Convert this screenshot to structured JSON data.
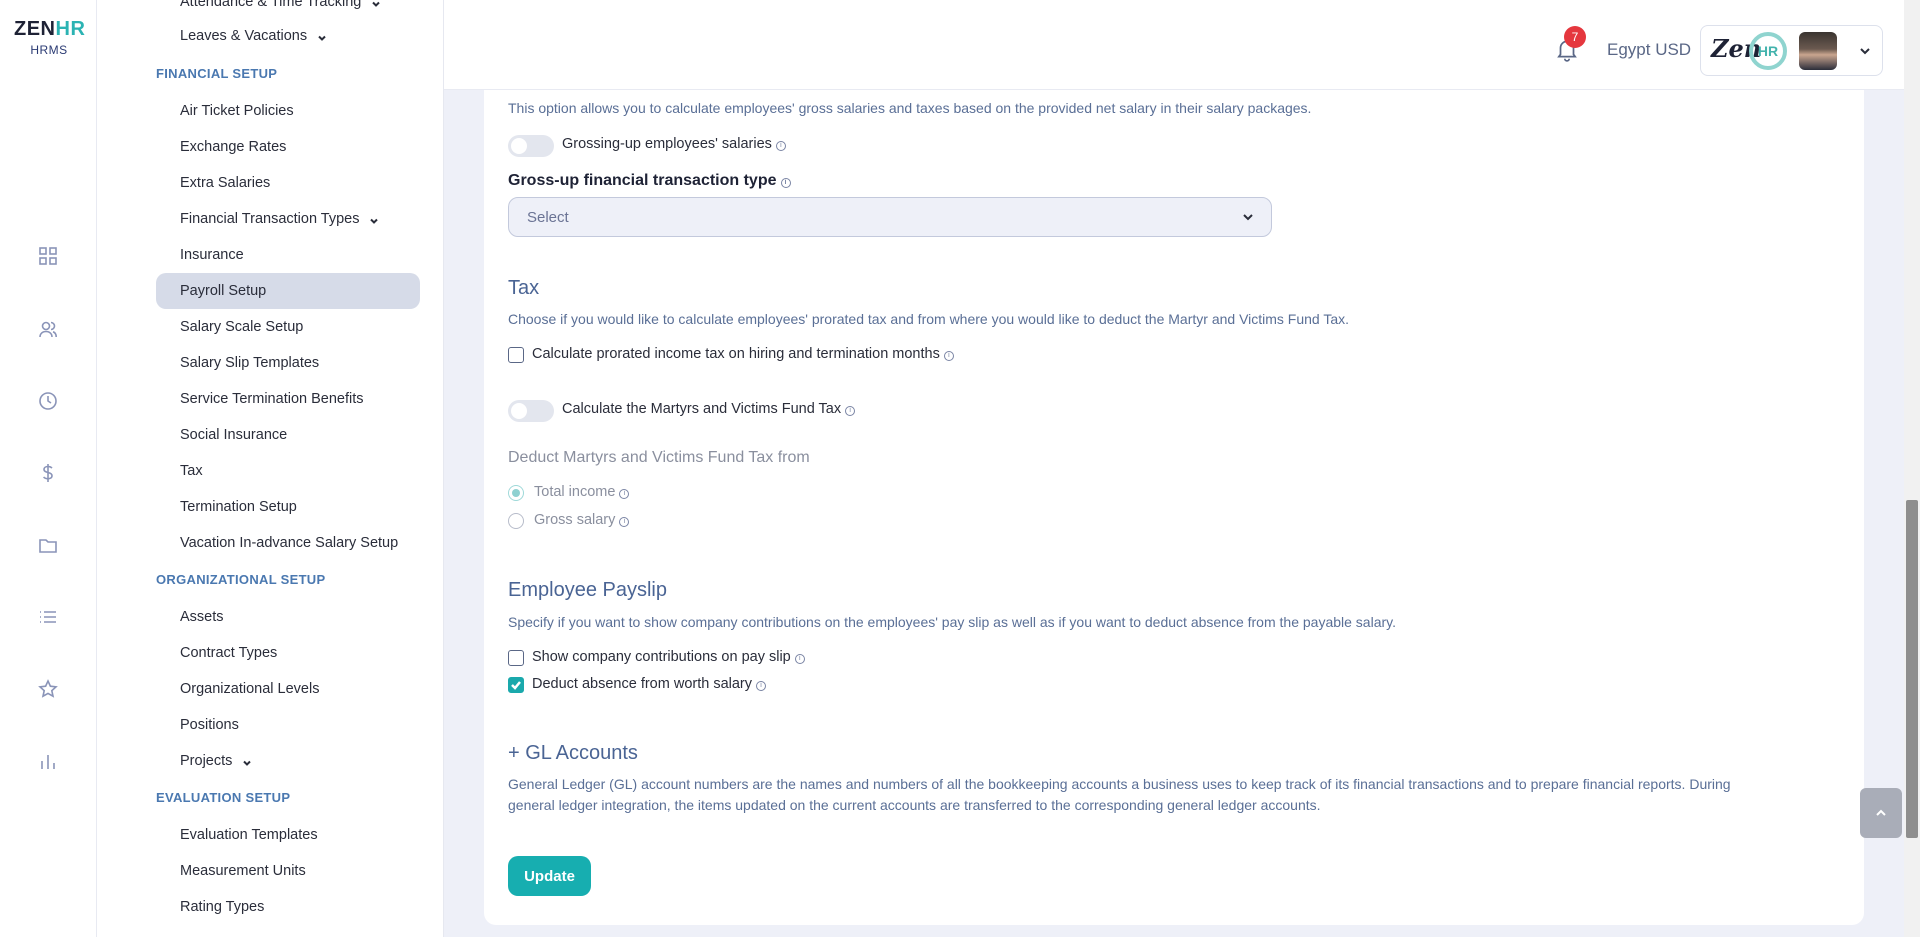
{
  "brand": {
    "zen": "ZEN",
    "hr": "HR",
    "sub": "HRMS"
  },
  "rail_icons": [
    "dashboard-icon",
    "users-icon",
    "clock-icon",
    "dollar-icon",
    "folder-icon",
    "list-icon",
    "star-icon",
    "chart-icon"
  ],
  "sidebar": {
    "top_items": [
      {
        "label": "Attendance & Time Tracking",
        "has_chevron": true
      },
      {
        "label": "Leaves & Vacations",
        "has_chevron": true
      }
    ],
    "financial": {
      "title": "FINANCIAL SETUP",
      "items": [
        {
          "label": "Air Ticket Policies"
        },
        {
          "label": "Exchange Rates"
        },
        {
          "label": "Extra Salaries"
        },
        {
          "label": "Financial Transaction Types",
          "has_chevron": true
        },
        {
          "label": "Insurance"
        },
        {
          "label": "Payroll Setup",
          "active": true
        },
        {
          "label": "Salary Scale Setup"
        },
        {
          "label": "Salary Slip Templates"
        },
        {
          "label": "Service Termination Benefits"
        },
        {
          "label": "Social Insurance"
        },
        {
          "label": "Tax"
        },
        {
          "label": "Termination Setup"
        },
        {
          "label": "Vacation In-advance Salary Setup"
        }
      ]
    },
    "organizational": {
      "title": "ORGANIZATIONAL SETUP",
      "items": [
        {
          "label": "Assets"
        },
        {
          "label": "Contract Types"
        },
        {
          "label": "Organizational Levels"
        },
        {
          "label": "Positions"
        },
        {
          "label": "Projects",
          "has_chevron": true
        }
      ]
    },
    "evaluation": {
      "title": "EVALUATION SETUP",
      "items": [
        {
          "label": "Evaluation Templates"
        },
        {
          "label": "Measurement Units"
        },
        {
          "label": "Rating Types"
        }
      ]
    }
  },
  "header": {
    "notification_count": "7",
    "currency": "Egypt USD",
    "profile_logo_text": "Zen",
    "profile_logo_circle": "HR"
  },
  "gross_up": {
    "description": "This option allows you to calculate employees' gross salaries and taxes based on the provided net salary in their salary packages.",
    "toggle_label": "Grossing-up employees' salaries",
    "toggle_on": false,
    "field_label": "Gross-up financial transaction type",
    "select_placeholder": "Select"
  },
  "tax": {
    "title": "Tax",
    "description": "Choose if you would like to calculate employees' prorated tax and from where you would like to deduct the Martyr and Victims Fund Tax.",
    "prorated_label": "Calculate prorated income tax on hiring and termination months",
    "prorated_checked": false,
    "martyrs_toggle_label": "Calculate the Martyrs and Victims Fund Tax",
    "martyrs_toggle_on": false,
    "deduct_title": "Deduct Martyrs and Victims Fund Tax from",
    "options": [
      {
        "label": "Total income",
        "checked": true
      },
      {
        "label": "Gross salary",
        "checked": false
      }
    ]
  },
  "payslip": {
    "title": "Employee Payslip",
    "description": "Specify if you want to show company contributions on the employees' pay slip as well as if you want to deduct absence from the payable salary.",
    "show_contrib_label": "Show company contributions on pay slip",
    "show_contrib_checked": false,
    "deduct_absence_label": "Deduct absence from worth salary",
    "deduct_absence_checked": true
  },
  "gl": {
    "title": "+ GL Accounts",
    "description_line1": "General Ledger (GL) account numbers are the names and numbers of all the bookkeeping accounts a business uses to keep track of its financial transactions and to prepare financial reports. During",
    "description_line2": "general ledger integration, the items updated on the current accounts are transferred to the corresponding general ledger accounts."
  },
  "actions": {
    "update_label": "Update"
  },
  "colors": {
    "accent": "#17aeb0",
    "badge": "#e5373e",
    "active_item": "#d6dbe8"
  }
}
